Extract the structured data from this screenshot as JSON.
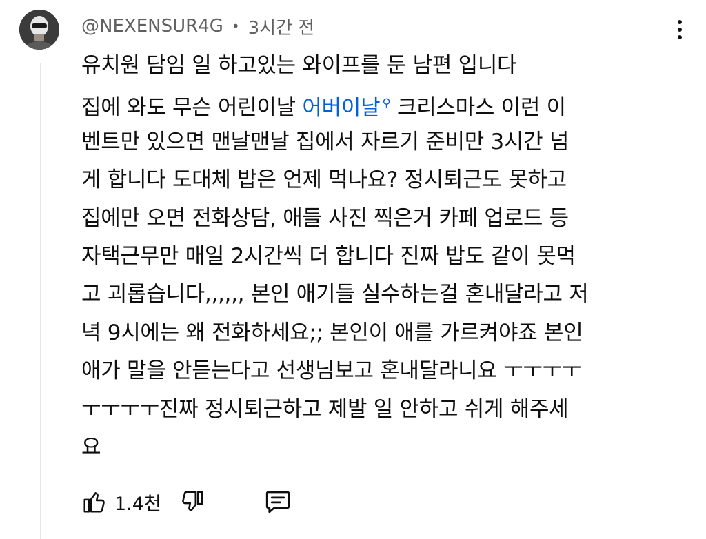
{
  "comment": {
    "author": "@NEXENSUR4G",
    "separator": "•",
    "time": "3시간 전",
    "lines": [
      {
        "pre": "유치원 담임 일 하고있는 와이프를 둔 남편 입니다"
      },
      {
        "pre": "집에 와도 무슨 어린이날 ",
        "link": "어버이날",
        "post": " 크리스마스 이런 이"
      },
      {
        "pre": "벤트만 있으면 맨날맨날 집에서 자르기 준비만 3시간 넘"
      },
      {
        "pre": "게 합니다 도대체 밥은 언제 먹나요? 정시퇴근도 못하고"
      },
      {
        "pre": "집에만 오면 전화상담, 애들 사진 찍은거 카페 업로드 등"
      },
      {
        "pre": "자택근무만 매일 2시간씩 더 합니다 진짜 밥도 같이 못먹"
      },
      {
        "pre": "고 괴롭습니다,,,,,, 본인 애기들 실수하는걸 혼내달라고 저"
      },
      {
        "pre": "녁 9시에는 왜 전화하세요;; 본인이 애를 가르켜야죠 본인"
      },
      {
        "pre": "애가 말을 안듣는다고 선생님보고 혼내달라니요 ㅜㅜㅜㅜ"
      },
      {
        "pre": "ㅜㅜㅜㅜ진짜 정시퇴근하고 제발 일 안하고 쉬게 해주세"
      },
      {
        "pre": "요"
      }
    ],
    "link_icon": "search-icon",
    "like_count": "1.4천"
  },
  "icons": {
    "like": "thumbs-up-icon",
    "dislike": "thumbs-down-icon",
    "reply": "reply-comment-icon",
    "menu": "more-vert-icon"
  },
  "colors": {
    "link": "#065fd4",
    "meta": "#606060",
    "text": "#0f0f0f"
  }
}
